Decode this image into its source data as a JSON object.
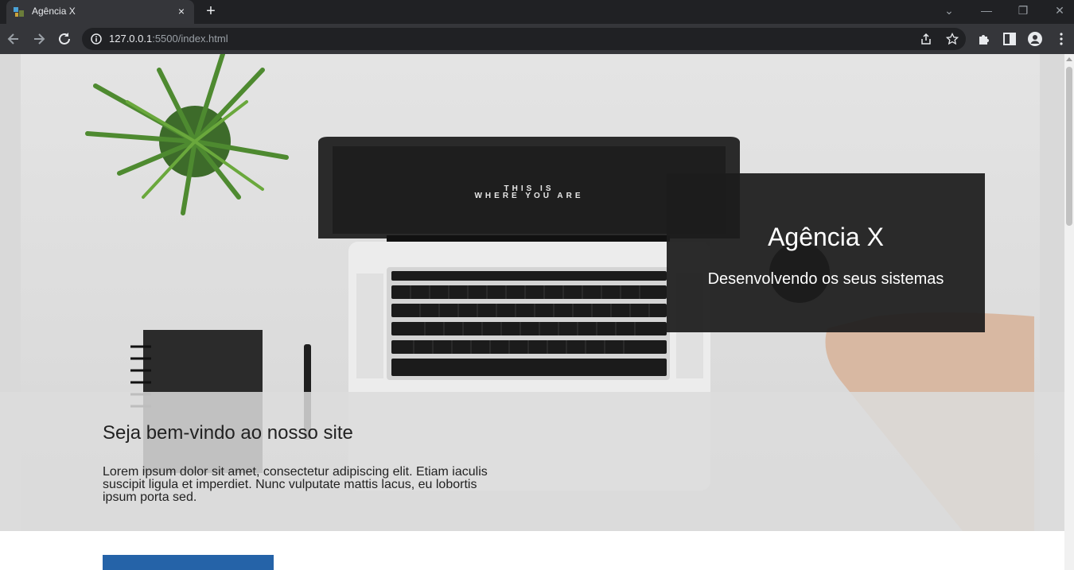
{
  "browser": {
    "tab": {
      "title": "Agência X",
      "close_label": "×"
    },
    "new_tab_label": "+",
    "window_controls": {
      "tab_search": "⌄",
      "minimize": "—",
      "restore": "❐",
      "close": "✕"
    },
    "address": {
      "host": "127.0.0.1",
      "rest": ":5500/index.html"
    },
    "icons": [
      "back-icon",
      "forward-icon",
      "reload-icon",
      "site-info-icon",
      "share-icon",
      "bookmark-star-icon",
      "extensions-icon",
      "side-panel-icon",
      "profile-icon",
      "menu-icon"
    ]
  },
  "hero": {
    "title": "Agência X",
    "subtitle": "Desenvolvendo os seus sistemas",
    "screen_text_line1": "THIS IS",
    "screen_text_line2": "WHERE YOU ARE"
  },
  "welcome": {
    "title": "Seja bem-vindo ao nosso site",
    "text": "Lorem ipsum dolor sit amet, consectetur adipiscing elit. Etiam iaculis suscipit ligula et imperdiet. Nunc vulputate mattis lacus, eu lobortis ipsum porta sed."
  },
  "colors": {
    "accent_blue": "#2563a8",
    "title_box": "#1c1c1c",
    "chrome_dark": "#202124",
    "chrome_toolbar": "#35363a"
  }
}
